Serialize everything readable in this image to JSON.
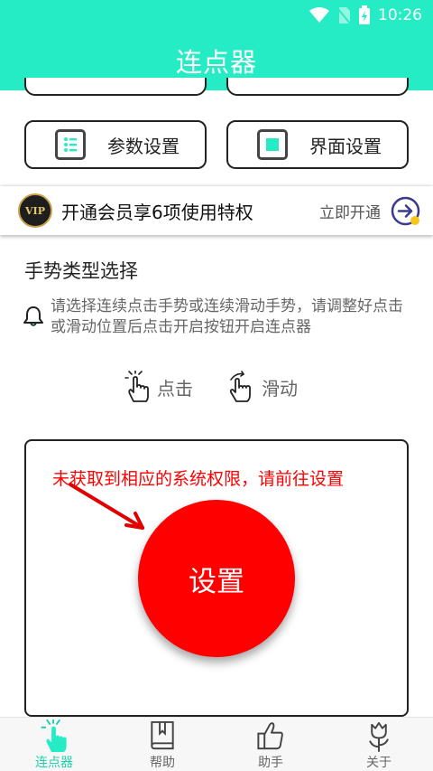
{
  "status": {
    "time": "10:26"
  },
  "app": {
    "title": "连点器"
  },
  "top_buttons": [
    {
      "label": "参数设置",
      "icon": "list-icon"
    },
    {
      "label": "界面设置",
      "icon": "square-icon"
    }
  ],
  "vip": {
    "badge": "VIP",
    "text": "开通会员享6项使用特权",
    "action": "立即开通",
    "icon": "arrow-circle-icon"
  },
  "gesture": {
    "title": "手势类型选择",
    "hint": "请选择连续点击手势或连续滑动手势，请调整好点击或滑动位置后点击开启按钮开启连点器",
    "modes": [
      {
        "label": "点击",
        "icon": "tap-hand-icon"
      },
      {
        "label": "滑动",
        "icon": "swipe-hand-icon"
      }
    ]
  },
  "permission": {
    "warning": "未获取到相应的系统权限，请前往设置",
    "button": "设置"
  },
  "nav": {
    "items": [
      {
        "label": "连点器",
        "icon": "tap-hand-icon",
        "active": true
      },
      {
        "label": "帮助",
        "icon": "book-icon",
        "active": false
      },
      {
        "label": "助手",
        "icon": "thumbs-up-icon",
        "active": false
      },
      {
        "label": "关于",
        "icon": "tulip-icon",
        "active": false
      }
    ]
  },
  "colors": {
    "header": "#26ecc6",
    "accent": "#1fcfae",
    "warning": "#ff0000"
  }
}
